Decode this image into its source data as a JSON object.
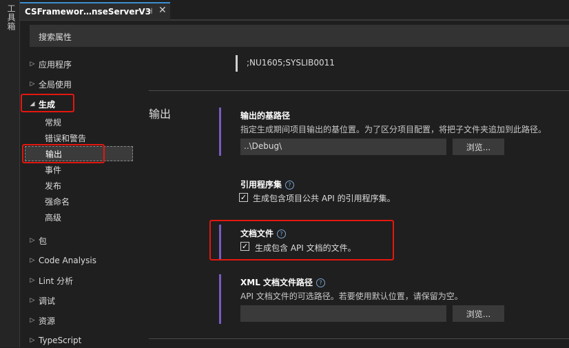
{
  "toolbox": {
    "label": "工具箱"
  },
  "tab": {
    "title": "CSFramewor…nseServerV3",
    "pin_icon": "pin-icon",
    "close_icon": "close-icon"
  },
  "search": {
    "placeholder": "搜索属性"
  },
  "nav": {
    "items": [
      {
        "label": "应用程序",
        "expanded": false
      },
      {
        "label": "全局使用",
        "expanded": false
      },
      {
        "label": "生成",
        "expanded": true
      },
      {
        "label": "常规"
      },
      {
        "label": "错误和警告"
      },
      {
        "label": "输出",
        "selected": true
      },
      {
        "label": "事件"
      },
      {
        "label": "发布"
      },
      {
        "label": "强命名"
      },
      {
        "label": "高级"
      },
      {
        "label": "包",
        "expanded": false
      },
      {
        "label": "Code Analysis",
        "expanded": false
      },
      {
        "label": "Lint 分析",
        "expanded": false
      },
      {
        "label": "调试",
        "expanded": false
      },
      {
        "label": "资源",
        "expanded": false
      },
      {
        "label": "TypeScript",
        "expanded": false
      }
    ]
  },
  "content": {
    "previous_value": ";NU1605;SYSLIB0011",
    "section_title": "输出",
    "base_path": {
      "title": "输出的基路径",
      "description": "指定生成期间项目输出的基位置。为了区分项目配置，将把子文件夹追加到此路径。",
      "value": "..\\Debug\\",
      "browse": "浏览..."
    },
    "ref_assembly": {
      "title": "引用程序集",
      "checkbox_label": "生成包含项目公共 API 的引用程序集。",
      "checked": true
    },
    "doc_file": {
      "title": "文档文件",
      "checkbox_label": "生成包含 API 文档的文件。",
      "checked": true
    },
    "xml_doc_path": {
      "title": "XML 文档文件路径",
      "description": "API 文档文件的可选路径。若要使用默认位置，请保留为空。",
      "value": "",
      "browse": "浏览..."
    }
  },
  "colors": {
    "accent": "#7a5bc3",
    "highlight_box": "#e4170f",
    "tab_accent": "#3e8ed0"
  }
}
